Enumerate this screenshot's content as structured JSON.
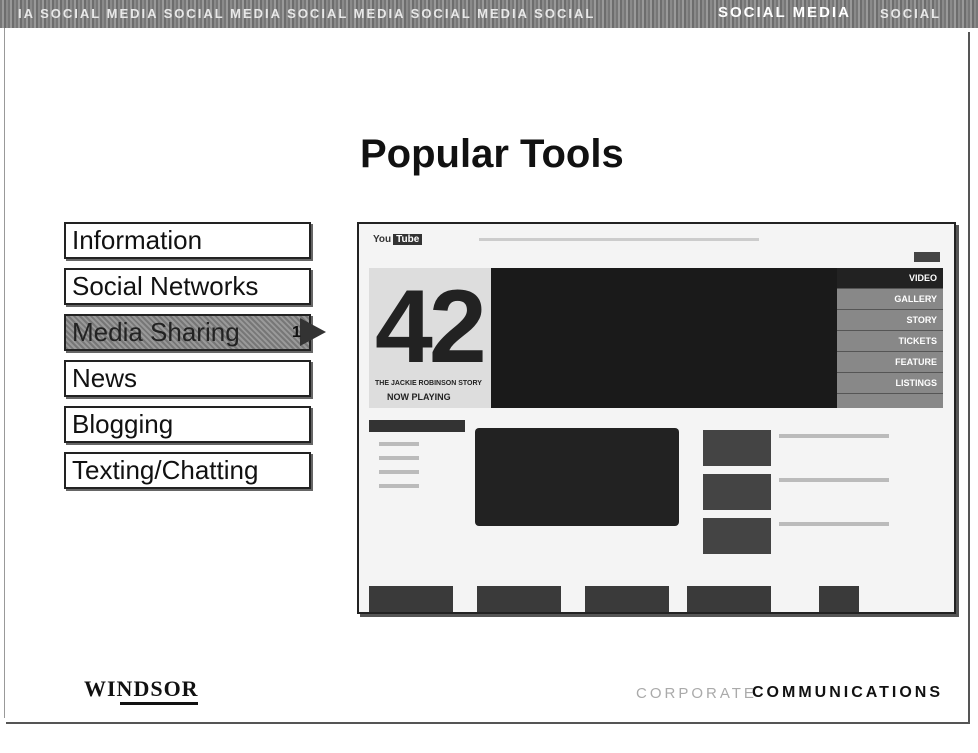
{
  "banner": {
    "faint_text": "IA SOCIAL MEDIA SOCIAL MEDIA SOCIAL MEDIA SOCIAL MEDIA SOCIAL",
    "bold_text": "SOCIAL MEDIA",
    "tail_text": "SOCIAL"
  },
  "slide": {
    "title": "Popular Tools",
    "menu": [
      {
        "label": "Information"
      },
      {
        "label": "Social Networks"
      },
      {
        "label": "Media Sharing"
      },
      {
        "label": "News"
      },
      {
        "label": "Blogging"
      },
      {
        "label": "Texting/Chatting"
      }
    ],
    "active_index": 2,
    "pointer_label": "1"
  },
  "screenshot": {
    "logo": "You",
    "logo_badge": "Tube",
    "hero_number": "42",
    "hero_subtitle": "THE JACKIE ROBINSON STORY",
    "hero_status": "NOW PLAYING",
    "hero_menu": [
      "VIDEO",
      "GALLERY",
      "STORY",
      "TICKETS",
      "FEATURE",
      "LISTINGS"
    ]
  },
  "footer": {
    "logo_text": "WINDSOR",
    "corp_prefix": "CORPORATE",
    "corp_bold": "COMMUNICATIONS"
  }
}
